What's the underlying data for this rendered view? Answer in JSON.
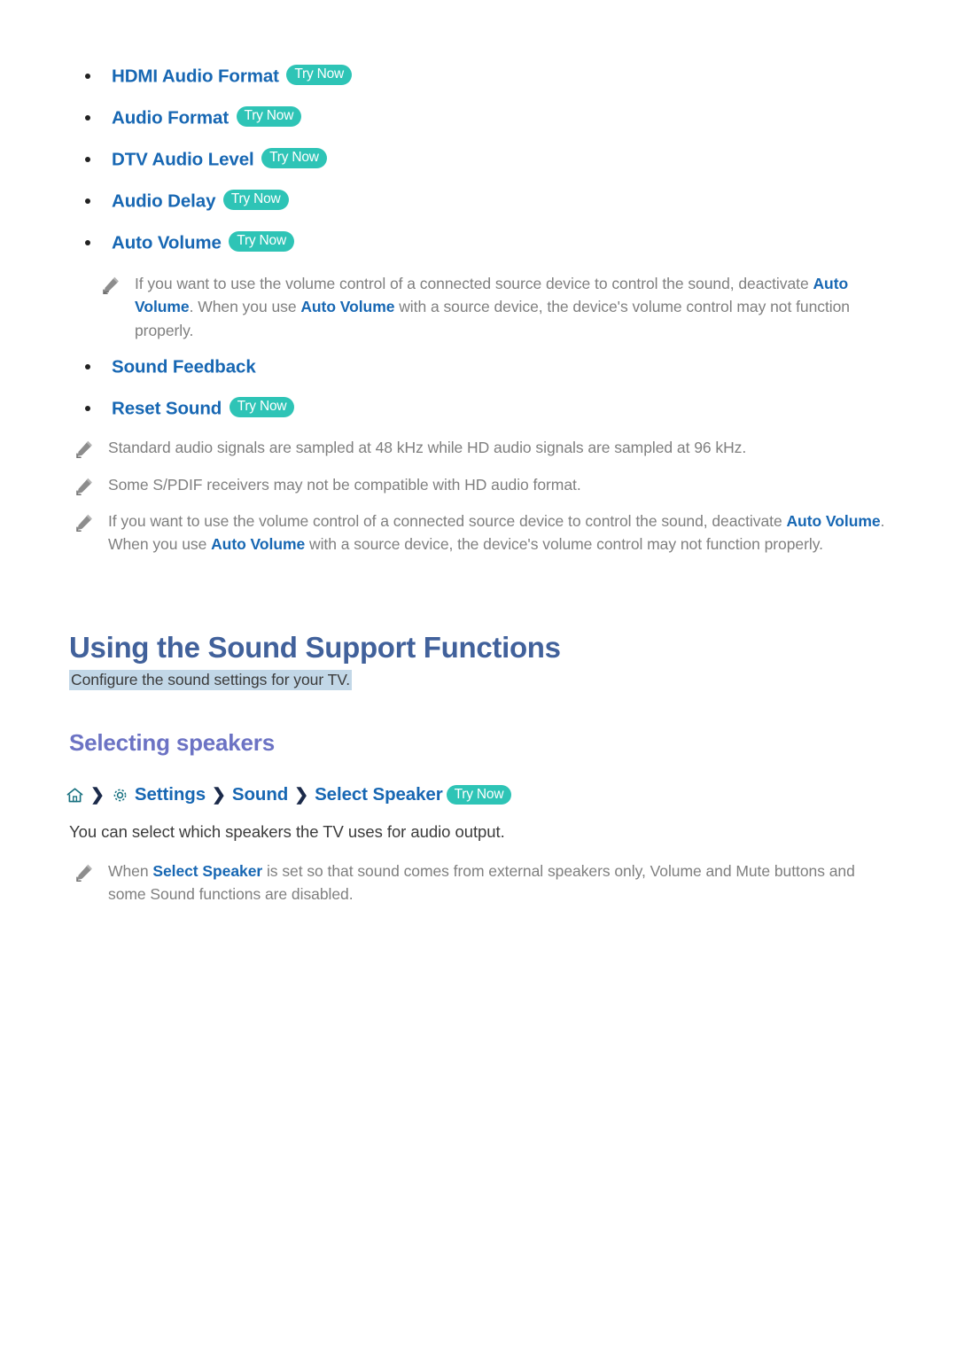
{
  "colors": {
    "link_blue": "#1767b3",
    "heading_blue": "#41619b",
    "subheading_purple": "#6c73c4",
    "badge_teal": "#2ec4b6",
    "note_gray": "#7f7f7f",
    "body_gray": "#3b3b3b",
    "highlight_bg": "#c2d7e7",
    "icon_teal": "#117a8b"
  },
  "badges": {
    "try_now": "Try Now"
  },
  "bullet_list": [
    {
      "label": "HDMI Audio Format",
      "badge": "Try Now"
    },
    {
      "label": "Audio Format",
      "badge": "Try Now"
    },
    {
      "label": "DTV Audio Level",
      "badge": "Try Now"
    },
    {
      "label": "Audio Delay",
      "badge": "Try Now"
    },
    {
      "label": "Auto Volume",
      "badge": "Try Now"
    }
  ],
  "bullet_list_2": [
    {
      "label": "Sound Feedback",
      "badge": ""
    },
    {
      "label": "Reset Sound",
      "badge": "Try Now"
    }
  ],
  "notes": {
    "auto_volume_note": {
      "part1": "If you want to use the volume control of a connected source device to control the sound, deactivate ",
      "link1": "Auto Volume",
      "part2": ". When you use ",
      "link2": "Auto Volume",
      "part3": " with a source device, the device's volume control may not function properly."
    },
    "sampling": "Standard audio signals are sampled at 48 kHz while HD audio signals are sampled at 96 kHz.",
    "spdif": "Some S/PDIF receivers may not be compatible with HD audio format.",
    "select_speaker_note": {
      "part1": "When ",
      "link1": "Select Speaker",
      "part2": " is set so that sound comes from external speakers only, Volume and Mute buttons and some Sound functions are disabled."
    }
  },
  "section": {
    "heading": "Using the Sound Support Functions",
    "subtitle": "Configure the sound settings for your TV.",
    "subheading": "Selecting speakers",
    "body": "You can select which speakers the TV uses for audio output."
  },
  "breadcrumb": {
    "home_icon": "home-icon",
    "gear_icon": "gear-icon",
    "separator": "❯",
    "settings": "Settings",
    "sound": "Sound",
    "select_speaker": "Select Speaker",
    "badge": "Try Now"
  }
}
